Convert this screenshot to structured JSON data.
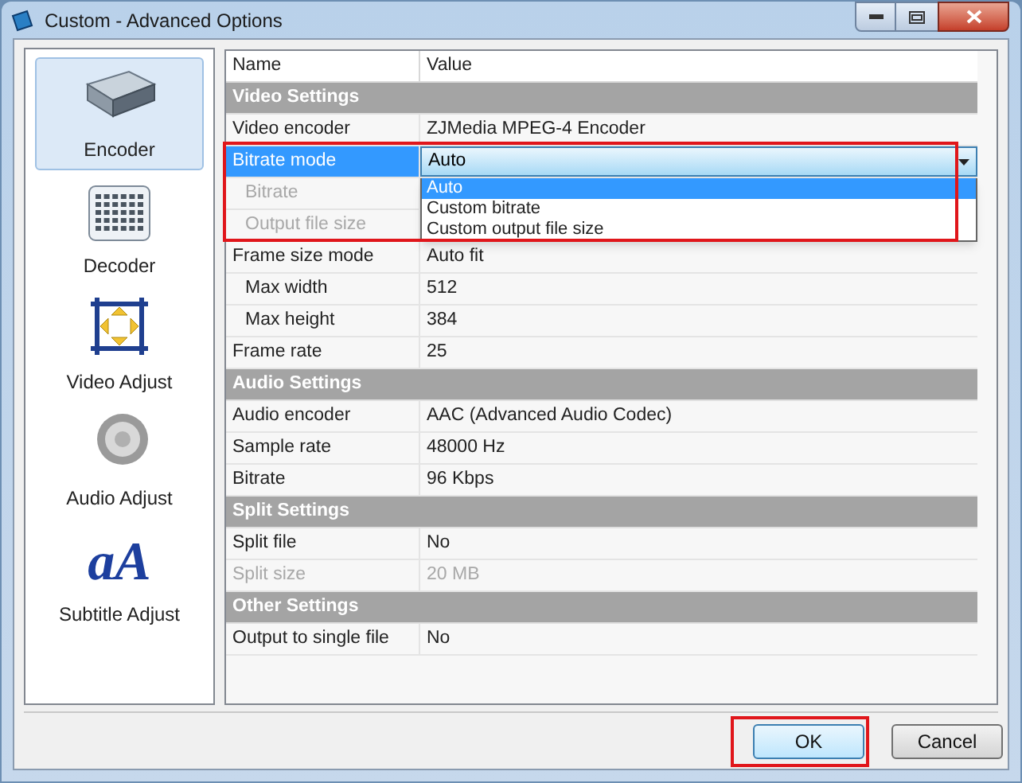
{
  "window": {
    "title": "Custom - Advanced Options"
  },
  "sidebar": {
    "items": [
      {
        "label": "Encoder",
        "kind": "encoder",
        "selected": true
      },
      {
        "label": "Decoder",
        "kind": "decoder",
        "selected": false
      },
      {
        "label": "Video Adjust",
        "kind": "video",
        "selected": false
      },
      {
        "label": "Audio Adjust",
        "kind": "audio",
        "selected": false
      },
      {
        "label": "Subtitle Adjust",
        "kind": "subtitle",
        "glyph": "aA",
        "selected": false
      }
    ]
  },
  "grid": {
    "columns": [
      "Name",
      "Value"
    ],
    "rows": [
      {
        "kind": "section",
        "name": "Video Settings"
      },
      {
        "kind": "property",
        "name": "Video encoder",
        "value": "ZJMedia MPEG-4 Encoder",
        "disabled": false,
        "indented": false,
        "selected": false
      },
      {
        "kind": "combo",
        "name": "Bitrate mode",
        "value": "Auto",
        "disabled": false,
        "indented": false,
        "selected": true,
        "expanded": true,
        "options": [
          {
            "label": "Auto",
            "selected": true
          },
          {
            "label": "Custom bitrate",
            "selected": false
          },
          {
            "label": "Custom output file size",
            "selected": false
          }
        ]
      },
      {
        "kind": "property",
        "name": "Bitrate",
        "disabled": true,
        "indented": true,
        "selected": false
      },
      {
        "kind": "property",
        "name": "Output file size",
        "disabled": true,
        "indented": true,
        "selected": false
      },
      {
        "kind": "property",
        "name": "Frame size mode",
        "value": "Auto fit",
        "disabled": false,
        "indented": false,
        "selected": false
      },
      {
        "kind": "property",
        "name": "Max width",
        "value": "512",
        "disabled": false,
        "indented": true,
        "selected": false
      },
      {
        "kind": "property",
        "name": "Max height",
        "value": "384",
        "disabled": false,
        "indented": true,
        "selected": false
      },
      {
        "kind": "property",
        "name": "Frame rate",
        "value": "25",
        "disabled": false,
        "indented": false,
        "selected": false
      },
      {
        "kind": "section",
        "name": "Audio Settings"
      },
      {
        "kind": "property",
        "name": "Audio encoder",
        "value": "AAC (Advanced Audio Codec)",
        "disabled": false,
        "indented": false,
        "selected": false
      },
      {
        "kind": "property",
        "name": "Sample rate",
        "value": "48000 Hz",
        "disabled": false,
        "indented": false,
        "selected": false
      },
      {
        "kind": "property",
        "name": "Bitrate",
        "value": "96 Kbps",
        "disabled": false,
        "indented": false,
        "selected": false
      },
      {
        "kind": "section",
        "name": "Split Settings"
      },
      {
        "kind": "property",
        "name": "Split file",
        "value": "No",
        "disabled": false,
        "indented": false,
        "selected": false
      },
      {
        "kind": "property",
        "name": "Split size",
        "value": "20 MB",
        "disabled": true,
        "indented": false,
        "selected": false
      },
      {
        "kind": "section",
        "name": "Other Settings"
      },
      {
        "kind": "property",
        "name": "Output to single file",
        "value": "No",
        "disabled": false,
        "indented": false,
        "selected": false
      }
    ]
  },
  "buttons": [
    {
      "label": "OK",
      "kind": "default",
      "highlighted": true
    },
    {
      "label": "Cancel",
      "kind": "normal",
      "highlighted": false
    }
  ]
}
